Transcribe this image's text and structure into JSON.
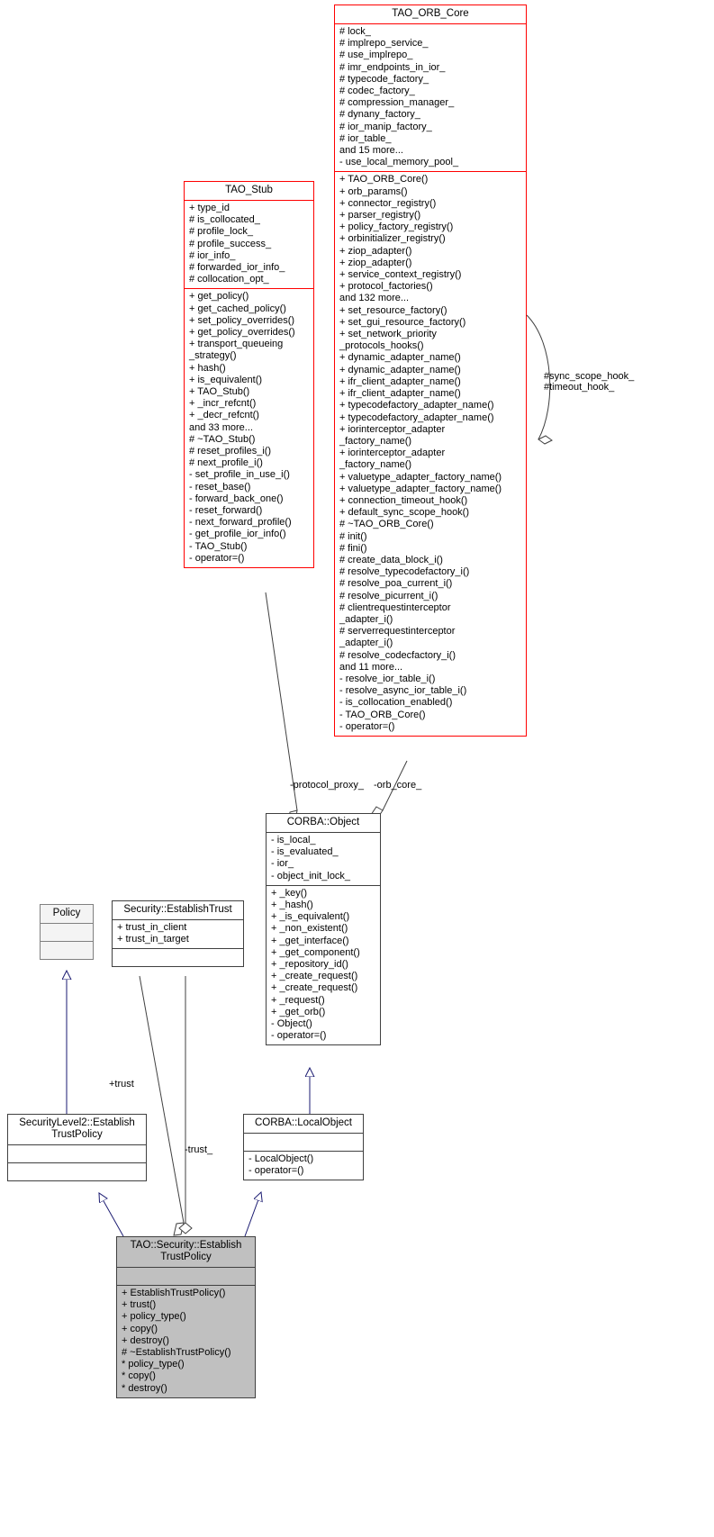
{
  "diagram": {
    "type": "uml-class-diagram",
    "colors": {
      "red_border": "#ff0000",
      "dark_border": "#404040",
      "grey_border": "#808080",
      "inheritance_line": "#191970",
      "association_line": "#404040",
      "highlight_fill": "#c0c0c0",
      "disabled_fill": "#f4f4f4"
    }
  },
  "classes": {
    "tao_orb_core": {
      "name": "TAO_ORB_Core",
      "attributes": [
        "# lock_",
        "# implrepo_service_",
        "# use_implrepo_",
        "# imr_endpoints_in_ior_",
        "# typecode_factory_",
        "# codec_factory_",
        "# compression_manager_",
        "# dynany_factory_",
        "# ior_manip_factory_",
        "# ior_table_",
        "and 15 more...",
        "- use_local_memory_pool_"
      ],
      "operations": [
        "+ TAO_ORB_Core()",
        "+ orb_params()",
        "+ connector_registry()",
        "+ parser_registry()",
        "+ policy_factory_registry()",
        "+ orbinitializer_registry()",
        "+ ziop_adapter()",
        "+ ziop_adapter()",
        "+ service_context_registry()",
        "+ protocol_factories()",
        "and 132 more...",
        "+ set_resource_factory()",
        "+ set_gui_resource_factory()",
        "+ set_network_priority",
        "_protocols_hooks()",
        "+ dynamic_adapter_name()",
        "+ dynamic_adapter_name()",
        "+ ifr_client_adapter_name()",
        "+ ifr_client_adapter_name()",
        "+ typecodefactory_adapter_name()",
        "+ typecodefactory_adapter_name()",
        "+ iorinterceptor_adapter",
        "_factory_name()",
        "+ iorinterceptor_adapter",
        "_factory_name()",
        "+ valuetype_adapter_factory_name()",
        "+ valuetype_adapter_factory_name()",
        "+ connection_timeout_hook()",
        "+ default_sync_scope_hook()",
        "# ~TAO_ORB_Core()",
        "# init()",
        "# fini()",
        "# create_data_block_i()",
        "# resolve_typecodefactory_i()",
        "# resolve_poa_current_i()",
        "# resolve_picurrent_i()",
        "# clientrequestinterceptor",
        "_adapter_i()",
        "# serverrequestinterceptor",
        "_adapter_i()",
        "# resolve_codecfactory_i()",
        "and 11 more...",
        "- resolve_ior_table_i()",
        "- resolve_async_ior_table_i()",
        "- is_collocation_enabled()",
        "- TAO_ORB_Core()",
        "- operator=()"
      ]
    },
    "tao_stub": {
      "name": "TAO_Stub",
      "attributes": [
        "+ type_id",
        "# is_collocated_",
        "# profile_lock_",
        "# profile_success_",
        "# ior_info_",
        "# forwarded_ior_info_",
        "# collocation_opt_"
      ],
      "operations": [
        "+ get_policy()",
        "+ get_cached_policy()",
        "+ set_policy_overrides()",
        "+ get_policy_overrides()",
        "+ transport_queueing",
        "_strategy()",
        "+ hash()",
        "+ is_equivalent()",
        "+ TAO_Stub()",
        "+ _incr_refcnt()",
        "+ _decr_refcnt()",
        "and 33 more...",
        "# ~TAO_Stub()",
        "# reset_profiles_i()",
        "# next_profile_i()",
        "- set_profile_in_use_i()",
        "- reset_base()",
        "- forward_back_one()",
        "- reset_forward()",
        "- next_forward_profile()",
        "- get_profile_ior_info()",
        "- TAO_Stub()",
        "- operator=()"
      ]
    },
    "corba_object": {
      "name": "CORBA::Object",
      "attributes": [
        "- is_local_",
        "- is_evaluated_",
        "- ior_",
        "- object_init_lock_"
      ],
      "operations": [
        "+ _key()",
        "+ _hash()",
        "+ _is_equivalent()",
        "+ _non_existent()",
        "+ _get_interface()",
        "+ _get_component()",
        "+ _repository_id()",
        "+ _create_request()",
        "+ _create_request()",
        "+ _request()",
        "+ _get_orb()",
        "- Object()",
        "- operator=()"
      ]
    },
    "corba_localobject": {
      "name": "CORBA::LocalObject",
      "attributes": [],
      "operations": [
        "- LocalObject()",
        "- operator=()"
      ]
    },
    "policy": {
      "name": "Policy",
      "attributes": [],
      "operations": []
    },
    "security_establishtrust": {
      "name": "Security::EstablishTrust",
      "attributes": [
        "+ trust_in_client",
        "+ trust_in_target"
      ],
      "operations": []
    },
    "securitylevel2_establishtrustpolicy": {
      "name": "SecurityLevel2::Establish\nTrustPolicy",
      "attributes": [],
      "operations": []
    },
    "tao_security_establishtrustpolicy": {
      "name": "TAO::Security::Establish\nTrustPolicy",
      "attributes": [],
      "operations": [
        "+ EstablishTrustPolicy()",
        "+ trust()",
        "+ policy_type()",
        "+ copy()",
        "+ destroy()",
        "# ~EstablishTrustPolicy()",
        "* policy_type()",
        "* copy()",
        "* destroy()"
      ]
    }
  },
  "edge_labels": {
    "sync_scope_hook": "#sync_scope_hook_\n#timeout_hook_",
    "protocol_proxy": "-protocol_proxy_",
    "orb_core": "-orb_core_",
    "trust_plus": "+trust",
    "trust_minus": "-trust_"
  }
}
